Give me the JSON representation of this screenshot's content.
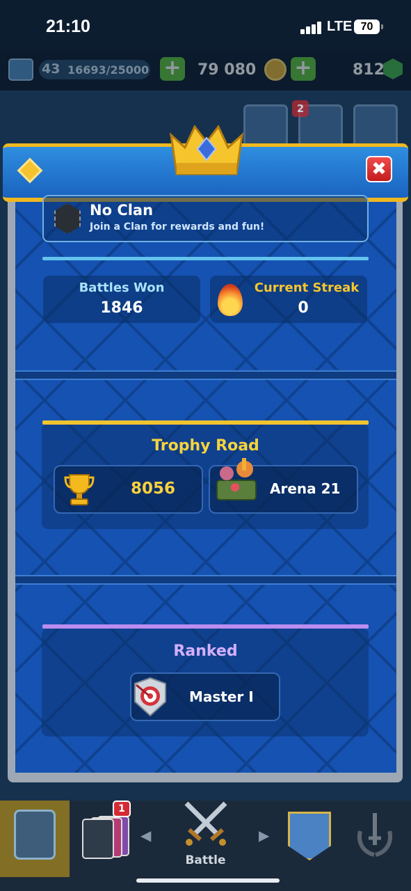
{
  "status_bar": {
    "time": "21:10",
    "network": "LTE",
    "battery": "70"
  },
  "resources": {
    "level": "43",
    "xp": "16693/25000",
    "gold": "79 080",
    "gems": "812",
    "plus_label": "+"
  },
  "header": {
    "notification_count": "2",
    "close_label": "✖"
  },
  "clan": {
    "title": "No Clan",
    "subtitle": "Join a Clan for rewards and fun!"
  },
  "stats": {
    "battles_won_label": "Battles Won",
    "battles_won": "1846",
    "streak_label": "Current Streak",
    "streak": "0"
  },
  "trophy_road": {
    "title": "Trophy Road",
    "trophies": "8056",
    "arena": "Arena 21"
  },
  "ranked": {
    "title": "Ranked",
    "rank": "Master I"
  },
  "bottom_nav": {
    "cards_badge": "1",
    "battle_label": "Battle",
    "arrow_left": "◀",
    "arrow_right": "▶"
  },
  "colors": {
    "accent_gold": "#f3c42f",
    "accent_blue": "#63c4ee",
    "accent_purple": "#bb8df1",
    "panel_blue": "#1552b2",
    "trophy_text": "#fbd13e",
    "streak_text": "#f7c62e",
    "battles_text": "#a9e2fb",
    "ranked_text": "#d4b0ff"
  }
}
